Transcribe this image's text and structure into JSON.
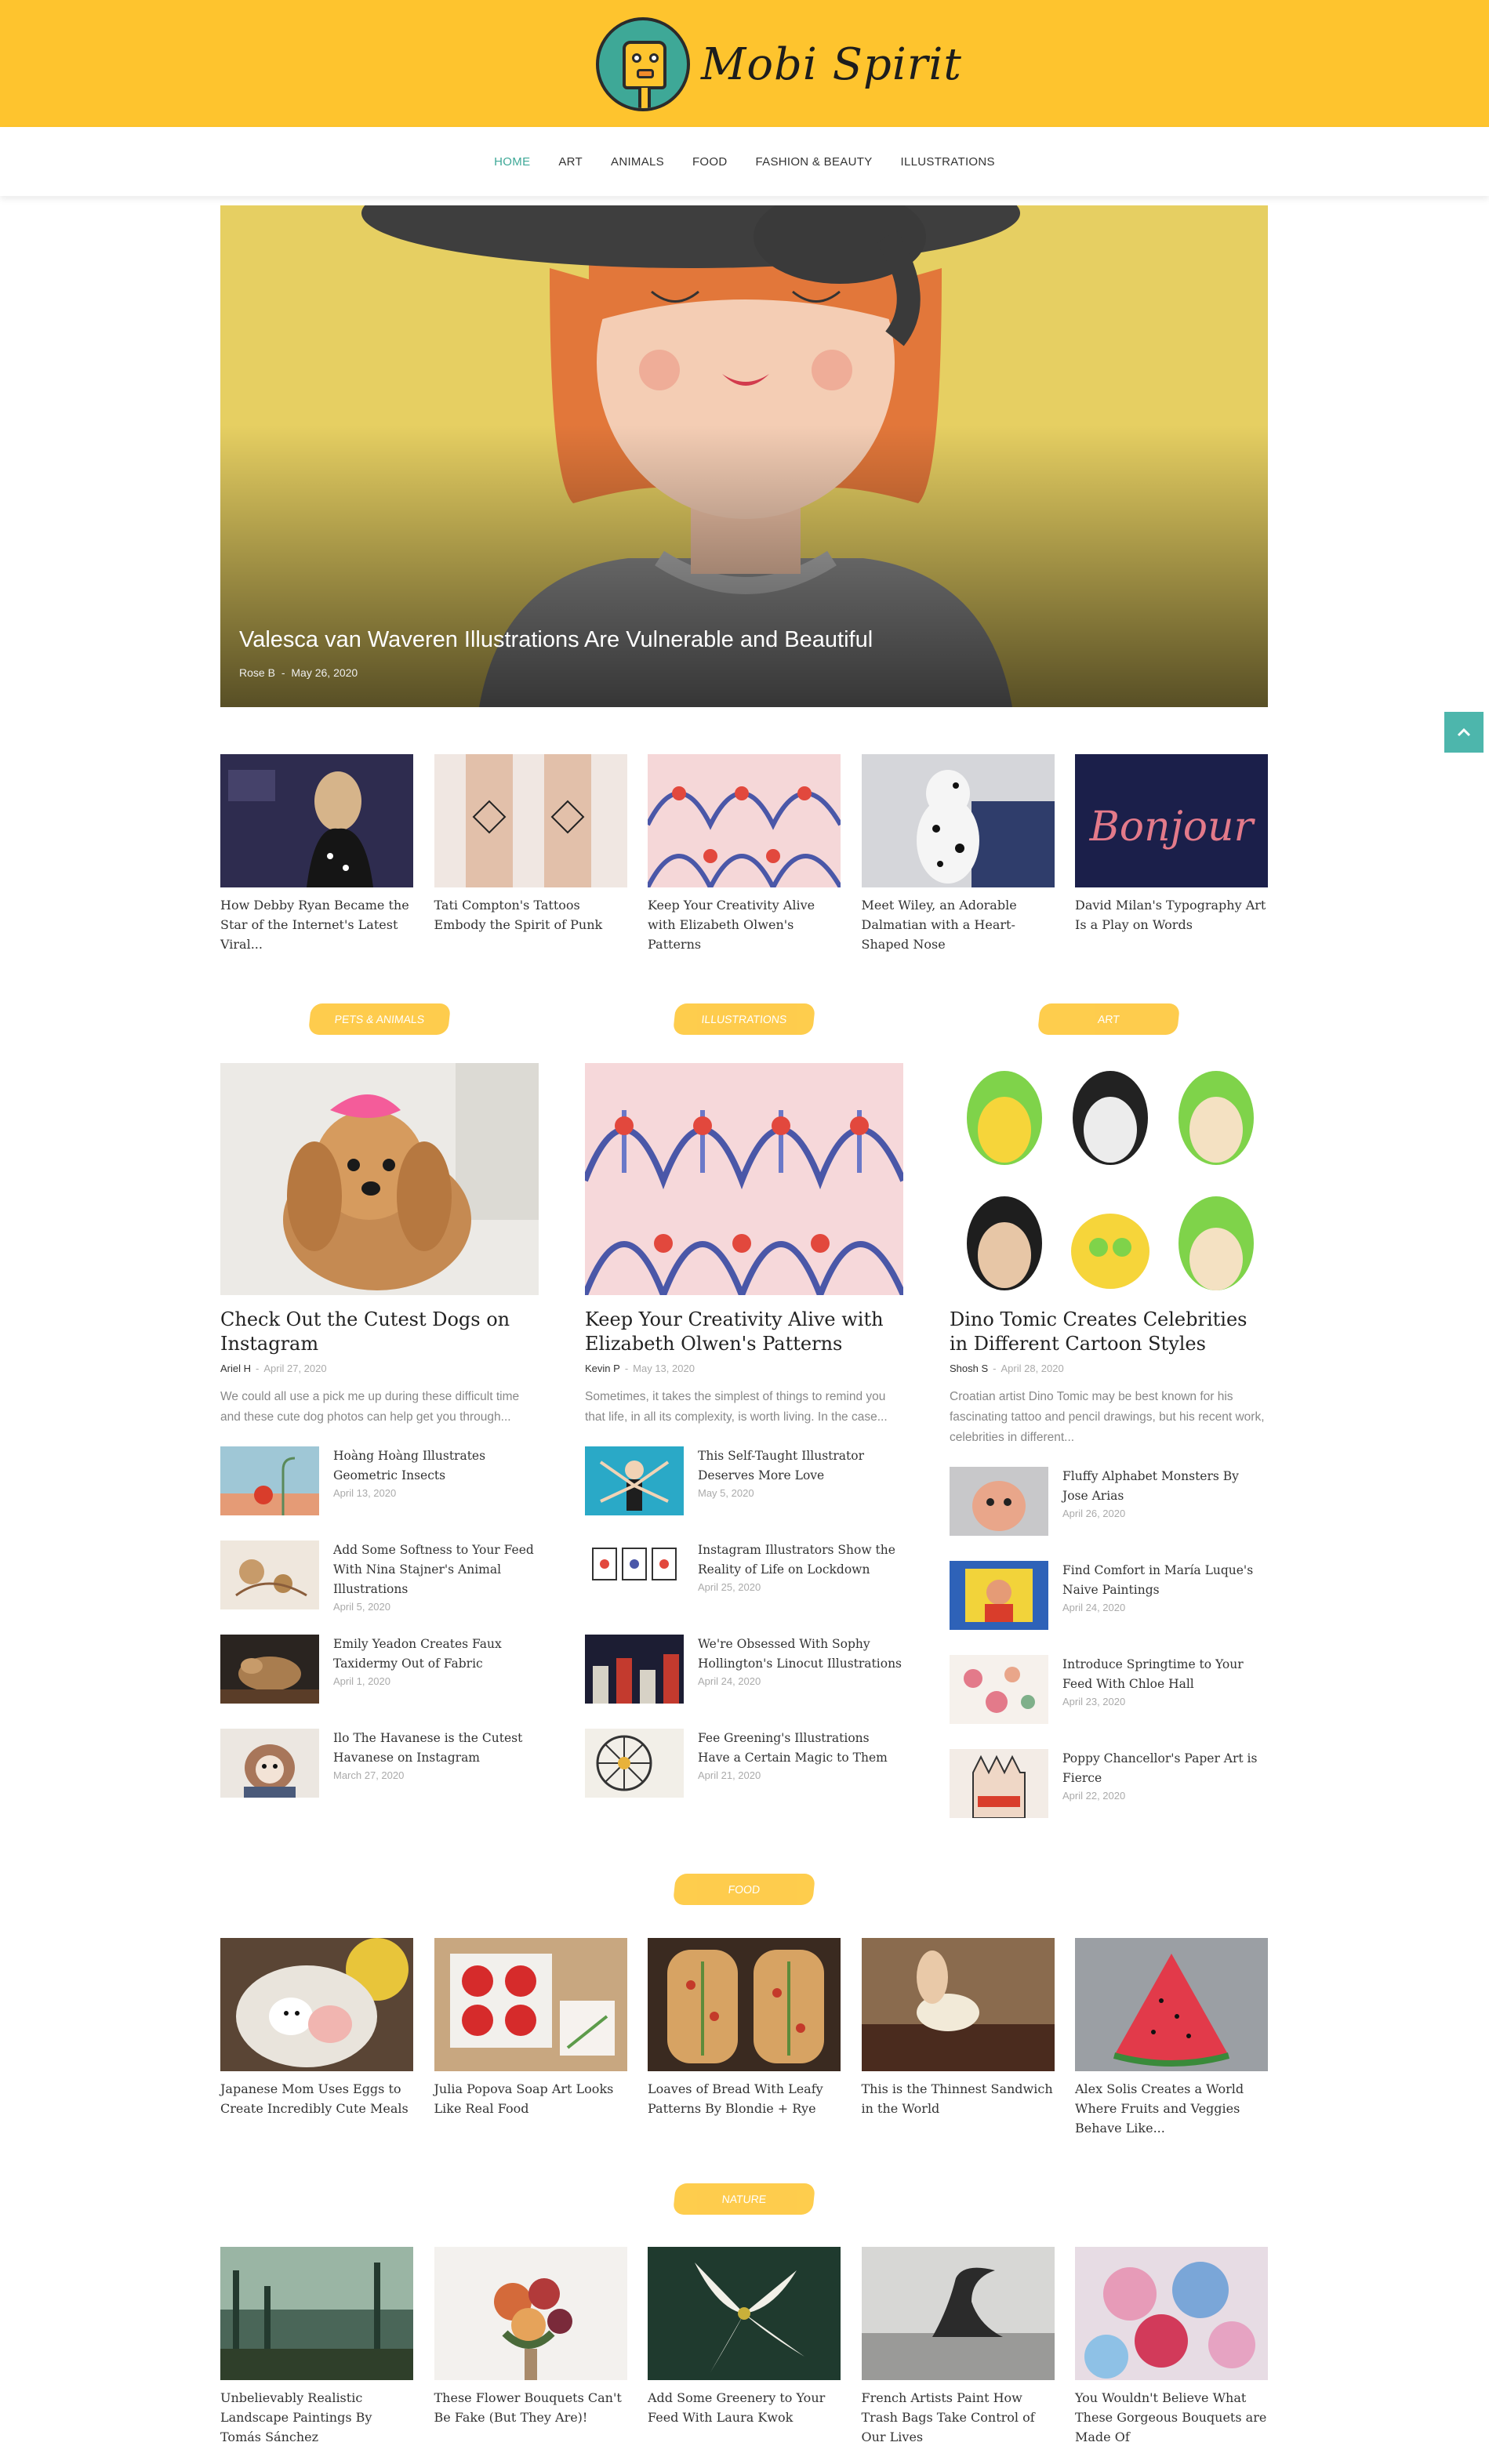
{
  "header": {
    "logo_text": "Mobi Spirit",
    "brand_color": "#fec42e",
    "accent_color": "#3ea897"
  },
  "nav": {
    "items": [
      {
        "label": "HOME",
        "active": true
      },
      {
        "label": "ART",
        "active": false
      },
      {
        "label": "ANIMALS",
        "active": false
      },
      {
        "label": "FOOD",
        "active": false
      },
      {
        "label": "FASHION & BEAUTY",
        "active": false
      },
      {
        "label": "ILLUSTRATIONS",
        "active": false
      }
    ]
  },
  "hero": {
    "title": "Valesca van Waveren Illustrations Are Vulnerable and Beautiful",
    "author": "Rose B",
    "date": "May 26, 2020"
  },
  "scroll_top_icon": "chevron-up-icon",
  "featured_row": [
    {
      "caption": "How Debby Ryan Became the Star of the Internet's Latest Viral..."
    },
    {
      "caption": "Tati Compton's Tattoos Embody the Spirit of Punk"
    },
    {
      "caption": "Keep Your Creativity Alive with Elizabeth Olwen's Patterns"
    },
    {
      "caption": "Meet Wiley, an Adorable Dalmatian with a Heart-Shaped Nose"
    },
    {
      "caption": "David Milan's Typography Art Is a Play on Words"
    }
  ],
  "sections": [
    {
      "badge": "PETS & ANIMALS",
      "main": {
        "title": "Check Out the Cutest Dogs on Instagram",
        "author": "Ariel H",
        "date": "April 27, 2020",
        "excerpt": "We could all use a pick me up during these difficult time and these cute dog photos can help get you through..."
      },
      "list": [
        {
          "title": "Hoàng Hoàng Illustrates Geometric Insects",
          "date": "April 13, 2020"
        },
        {
          "title": "Add Some Softness to Your Feed With Nina Stajner's Animal Illustrations",
          "date": "April 5, 2020"
        },
        {
          "title": "Emily Yeadon Creates Faux Taxidermy Out of Fabric",
          "date": "April 1, 2020"
        },
        {
          "title": "Ilo The Havanese is the Cutest Havanese on Instagram",
          "date": "March 27, 2020"
        }
      ]
    },
    {
      "badge": "ILLUSTRATIONS",
      "main": {
        "title": "Keep Your Creativity Alive with Elizabeth Olwen's Patterns",
        "author": "Kevin P",
        "date": "May 13, 2020",
        "excerpt": "Sometimes, it takes the simplest of things to remind you that life, in all its complexity, is worth living. In the case..."
      },
      "list": [
        {
          "title": "This Self-Taught Illustrator Deserves More Love",
          "date": "May 5, 2020"
        },
        {
          "title": "Instagram Illustrators Show the Reality of Life on Lockdown",
          "date": "April 25, 2020"
        },
        {
          "title": "We're Obsessed With Sophy Hollington's Linocut Illustrations",
          "date": "April 24, 2020"
        },
        {
          "title": "Fee Greening's Illustrations Have a Certain Magic to Them",
          "date": "April 21, 2020"
        }
      ]
    },
    {
      "badge": "ART",
      "main": {
        "title": "Dino Tomic Creates Celebrities in Different Cartoon Styles",
        "author": "Shosh S",
        "date": "April 28, 2020",
        "excerpt": "Croatian artist Dino Tomic may be best known for his fascinating tattoo and pencil drawings, but his recent work, celebrities in different..."
      },
      "list": [
        {
          "title": "Fluffy Alphabet Monsters By Jose Arias",
          "date": "April 26, 2020"
        },
        {
          "title": "Find Comfort in María Luque's Naive Paintings",
          "date": "April 24, 2020"
        },
        {
          "title": "Introduce Springtime to Your Feed With Chloe Hall",
          "date": "April 23, 2020"
        },
        {
          "title": "Poppy Chancellor's Paper Art is Fierce",
          "date": "April 22, 2020"
        }
      ]
    }
  ],
  "food": {
    "badge": "FOOD",
    "items": [
      {
        "caption": "Japanese Mom Uses Eggs to Create Incredibly Cute Meals"
      },
      {
        "caption": "Julia Popova Soap Art Looks Like Real Food"
      },
      {
        "caption": "Loaves of Bread With Leafy Patterns By Blondie + Rye"
      },
      {
        "caption": "This is the Thinnest Sandwich in the World"
      },
      {
        "caption": "Alex Solis Creates a World Where Fruits and Veggies Behave Like..."
      }
    ]
  },
  "nature": {
    "badge": "NATURE",
    "items": [
      {
        "caption": "Unbelievably Realistic Landscape Paintings By Tomás Sánchez"
      },
      {
        "caption": "These Flower Bouquets Can't Be Fake (But They Are)!"
      },
      {
        "caption": "Add Some Greenery to Your Feed With Laura Kwok"
      },
      {
        "caption": "French Artists Paint How Trash Bags Take Control of Our Lives"
      },
      {
        "caption": "You Wouldn't Believe What These Gorgeous Bouquets are Made Of"
      }
    ]
  }
}
